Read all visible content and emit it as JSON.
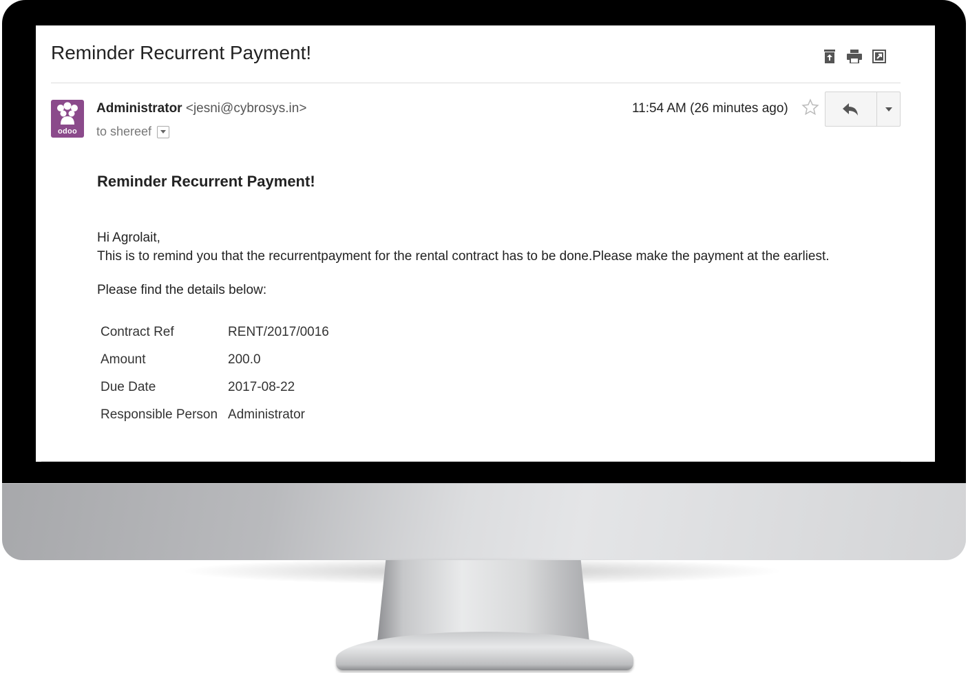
{
  "email": {
    "subject": "Reminder Recurrent Payment!",
    "sender": {
      "name": "Administrator",
      "email": "<jesni@cybrosys.in>",
      "avatar_text": "odoo"
    },
    "recipient": "to shereef",
    "timestamp": "11:54 AM (26 minutes ago)",
    "body": {
      "heading": "Reminder Recurrent Payment!",
      "greeting": "Hi Agrolait,",
      "message": "This is to remind you that the recurrentpayment for the rental contract has to be done.Please make the payment at the earliest.",
      "details_intro": "Please find the details below:",
      "details": [
        {
          "label": "Contract Ref",
          "value": "RENT/2017/0016"
        },
        {
          "label": "Amount",
          "value": "200.0"
        },
        {
          "label": "Due Date",
          "value": "2017-08-22"
        },
        {
          "label": "Responsible Person",
          "value": "Administrator"
        }
      ]
    }
  },
  "icons": {
    "top": [
      "archive-icon",
      "print-icon",
      "open-new-window-icon"
    ],
    "star": "star-icon",
    "reply": "reply-icon",
    "more": "caret-down-icon"
  },
  "colors": {
    "avatar_bg": "#8b4a8b",
    "bezel": "#000000"
  }
}
